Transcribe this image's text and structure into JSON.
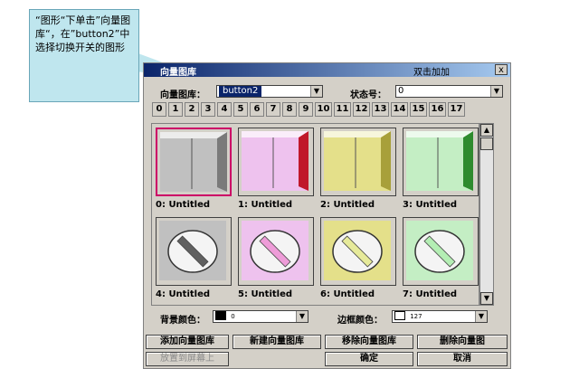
{
  "callout": {
    "text": "“图形“下单击”向量图库“，在”button2”中选择切换开关的图形"
  },
  "dialog": {
    "title": "向量图库",
    "title_action": "双击加加",
    "close": "x",
    "library_label": "向量图库：",
    "library_value": "button2",
    "state_label": "状态号：",
    "state_value": "0",
    "tabs": [
      "0",
      "1",
      "2",
      "3",
      "4",
      "5",
      "6",
      "7",
      "8",
      "9",
      "10",
      "11",
      "12",
      "13",
      "14",
      "15",
      "16",
      "17"
    ],
    "items": [
      {
        "caption": "0: Untitled",
        "kind": "switch",
        "color": "#c0c0c0",
        "edge": "#7a7a7a",
        "selected": true
      },
      {
        "caption": "1: Untitled",
        "kind": "switch",
        "color": "#eec2ee",
        "edge": "#c0182a",
        "selected": false
      },
      {
        "caption": "2: Untitled",
        "kind": "switch",
        "color": "#e4e08a",
        "edge": "#a8a03a",
        "selected": false
      },
      {
        "caption": "3: Untitled",
        "kind": "switch",
        "color": "#c4eec4",
        "edge": "#2e8b2e",
        "selected": false
      },
      {
        "caption": "4: Untitled",
        "kind": "knob",
        "color": "#c0c0c0",
        "handle": "#606060",
        "selected": false
      },
      {
        "caption": "5: Untitled",
        "kind": "knob",
        "color": "#eec2ee",
        "handle": "#ee9cd8",
        "selected": false
      },
      {
        "caption": "6: Untitled",
        "kind": "knob",
        "color": "#e4e08a",
        "handle": "#e6ea9a",
        "selected": false
      },
      {
        "caption": "7: Untitled",
        "kind": "knob",
        "color": "#c4eec4",
        "handle": "#b4eeb4",
        "selected": false
      }
    ],
    "bg_color_label": "背景颜色：",
    "bg_color_value": "0",
    "border_color_label": "边框颜色：",
    "border_color_value": "127",
    "buttons": {
      "add": "添加向量图库",
      "new": "新建向量图库",
      "remove": "移除向量图库",
      "delete": "删除向量图",
      "place": "放置到屏幕上",
      "ok": "确定",
      "cancel": "取消"
    }
  }
}
